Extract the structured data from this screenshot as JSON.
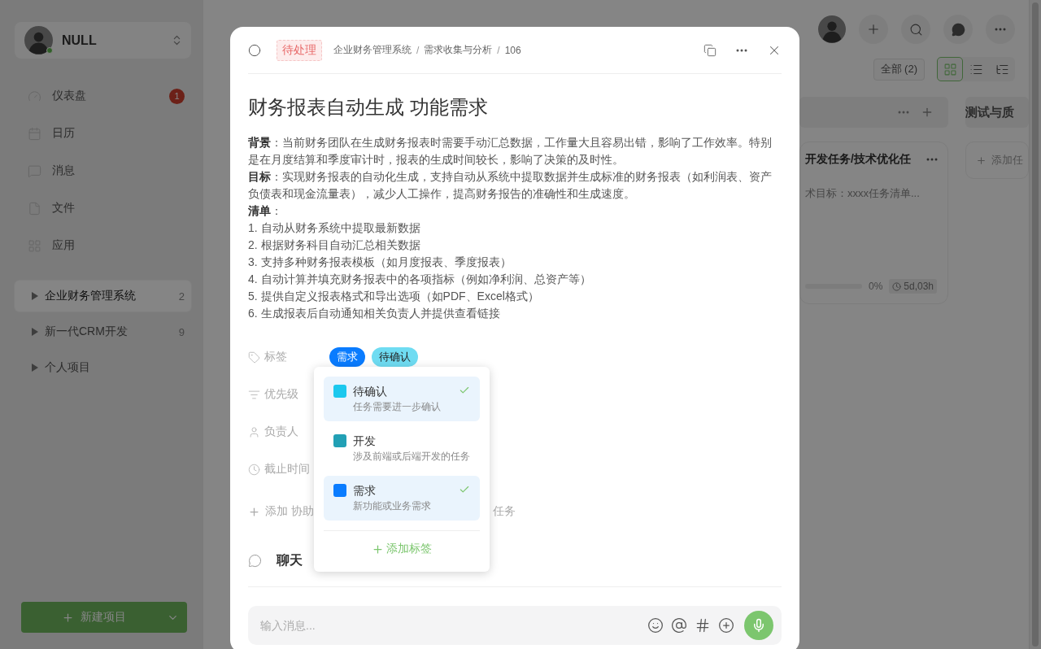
{
  "sidebar": {
    "profile": {
      "name": "NULL",
      "online": true
    },
    "nav": [
      {
        "label": "仪表盘",
        "kind": "dashboard",
        "badge": "1"
      },
      {
        "label": "日历",
        "kind": "calendar"
      },
      {
        "label": "消息",
        "kind": "messages"
      },
      {
        "label": "文件",
        "kind": "files"
      },
      {
        "label": "应用",
        "kind": "apps"
      }
    ],
    "projects": [
      {
        "name": "企业财务管理系统",
        "count": "2",
        "selected": true,
        "expanded": false
      },
      {
        "name": "新一代CRM开发",
        "count": "9",
        "selected": false,
        "expanded": false
      },
      {
        "name": "个人项目",
        "selected": false,
        "expanded": false
      }
    ],
    "new_project_button": "新建项目"
  },
  "board": {
    "filter": "全部 (2)",
    "views": [
      {
        "kind": "grid",
        "selected": true
      },
      {
        "kind": "list",
        "selected": false
      },
      {
        "kind": "tree",
        "selected": false
      }
    ],
    "columns": [
      {
        "kind": "cards",
        "card": {
          "title": "开发任务/技术优化任",
          "description": "术目标：xxxx任务清单...",
          "progress": {
            "level": 0,
            "reading": "0%"
          },
          "duration": "5d,03h"
        }
      },
      {
        "kind": "empty",
        "title": "测试与质",
        "add_task": "添加任"
      }
    ]
  },
  "task_dialog": {
    "status": "待处理",
    "breadcrumb": {
      "separator": "/",
      "items": [
        "企业财务管理系统",
        "需求收集与分析",
        "106"
      ]
    },
    "title": "财务报表自动生成 功能需求",
    "description": [
      "**背景**：当前财务团队在生成财务报表时需要手动汇总数据，工作量大且容易出错，影响了工作效率。特别是在月度结算和季度审计时，报表的生成时间较长，影响了决策的及时性。",
      "**目标**：实现财务报表的自动化生成，支持自动从系统中提取数据并生成标准的财务报表（如利润表、资产负债表和现金流量表），减少人工操作，提高财务报告的准确性和生成速度。",
      "**清单**：",
      "1. 自动从财务系统中提取最新数据",
      "2. 根据财务科目自动汇总相关数据",
      "3. 支持多种财务报表模板（如月度报表、季度报表）",
      "4. 自动计算并填充财务报表中的各项指标（例如净利润、总资产等）",
      "5. 提供自定义报表格式和导出选项（如PDF、Excel格式）",
      "6. 生成报表后自动通知相关负责人并提供查看链接"
    ],
    "fields": [
      {
        "kind": "tags",
        "label": "标签",
        "tags": [
          {
            "label": "需求",
            "color": "#0a7cff"
          },
          {
            "label": "待确认",
            "color": "#6fdcf2"
          }
        ]
      },
      {
        "kind": "priority",
        "label": "优先级"
      },
      {
        "kind": "assignee",
        "label": "负责人"
      },
      {
        "kind": "deadline",
        "label": "截止时间"
      }
    ],
    "add_row": {
      "left": "添加 协助",
      "right": "任务"
    },
    "chat": {
      "title": "聊天",
      "placeholder": "输入消息..."
    },
    "tag_menu": {
      "items": [
        {
          "name": "待确认",
          "description": "任务需要进一步确认",
          "color": "#1cc8ee",
          "selected": true
        },
        {
          "name": "开发",
          "description": "涉及前端或后端开发的任务",
          "color": "#22a0b5",
          "selected": false
        },
        {
          "name": "需求",
          "description": "新功能或业务需求",
          "color": "#0a7cff",
          "selected": true
        }
      ],
      "add_label": "添加标签"
    }
  }
}
